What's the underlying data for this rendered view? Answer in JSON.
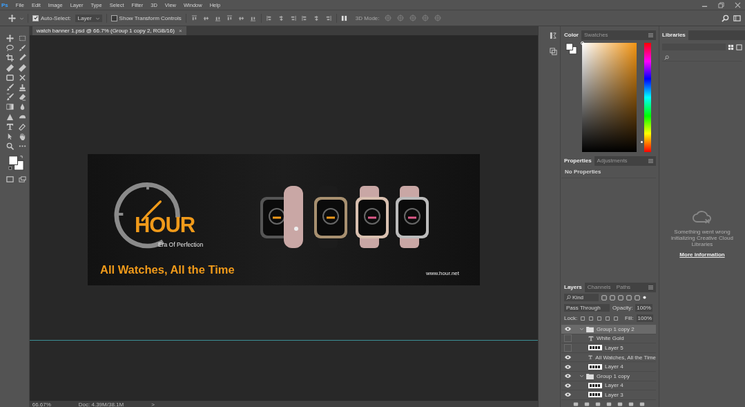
{
  "app_logo": "Ps",
  "menu": [
    "File",
    "Edit",
    "Image",
    "Layer",
    "Type",
    "Select",
    "Filter",
    "3D",
    "View",
    "Window",
    "Help"
  ],
  "options_bar": {
    "auto_select": {
      "label": "Auto-Select:",
      "checked": true
    },
    "target": "Layer",
    "transform_controls": {
      "label": "Show Transform Controls",
      "checked": false
    },
    "mode_label": "3D Mode:"
  },
  "document_tabs": [
    {
      "title": "watch banner 1.psd @ 66.7% (Group 1 copy 2, RGB/16)",
      "close": "×",
      "selected": true
    }
  ],
  "banner": {
    "brand": "HOUR",
    "tagline": "Era Of Perfection",
    "headline": "All Watches, All the Time",
    "website": "www.hour.net"
  },
  "status_bar": {
    "zoom": "66.67%",
    "doc": "Doc: 4.39M/38.1M",
    "arrow": ">"
  },
  "color_panel": {
    "tabs": [
      {
        "label": "Color",
        "selected": true
      },
      {
        "label": "Swatches",
        "selected": false
      }
    ],
    "hue_slider": {
      "level": 0.08
    }
  },
  "properties_panel": {
    "tabs": [
      {
        "label": "Properties",
        "selected": true
      },
      {
        "label": "Adjustments",
        "selected": false
      }
    ],
    "message": "No Properties"
  },
  "layers_panel": {
    "tabs": [
      {
        "label": "Layers",
        "selected": true
      },
      {
        "label": "Channels",
        "selected": false
      },
      {
        "label": "Paths",
        "selected": false
      }
    ],
    "filter": "Kind",
    "blend_mode": "Pass Through",
    "opacity_label": "Opacity:",
    "opacity": "100%",
    "lock_label": "Lock:",
    "fill_label": "Fill:",
    "fill": "100%",
    "layers": [
      {
        "name": "Group 1 copy 2",
        "kind": "group",
        "visible": true,
        "expanded": true,
        "selected": true,
        "children": [
          {
            "name": "White Gold",
            "kind": "text",
            "visible": false,
            "selected": false
          },
          {
            "name": "Layer 5",
            "kind": "pixel",
            "visible": false,
            "selected": false
          },
          {
            "name": "All Watches, All the Time",
            "kind": "text",
            "visible": true,
            "selected": false
          },
          {
            "name": "Layer 4",
            "kind": "pixel",
            "visible": true,
            "selected": false
          }
        ]
      },
      {
        "name": "Group 1 copy",
        "kind": "group",
        "visible": true,
        "expanded": true,
        "selected": false,
        "children": [
          {
            "name": "Layer 4",
            "kind": "pixel",
            "visible": true,
            "selected": false
          },
          {
            "name": "Layer 3",
            "kind": "pixel",
            "visible": true,
            "selected": false
          }
        ]
      }
    ]
  },
  "libraries_panel": {
    "tabs": [
      {
        "label": "Libraries",
        "selected": true
      }
    ],
    "error": "Something went wrong initializing Creative Cloud Libraries",
    "link": "More information"
  }
}
